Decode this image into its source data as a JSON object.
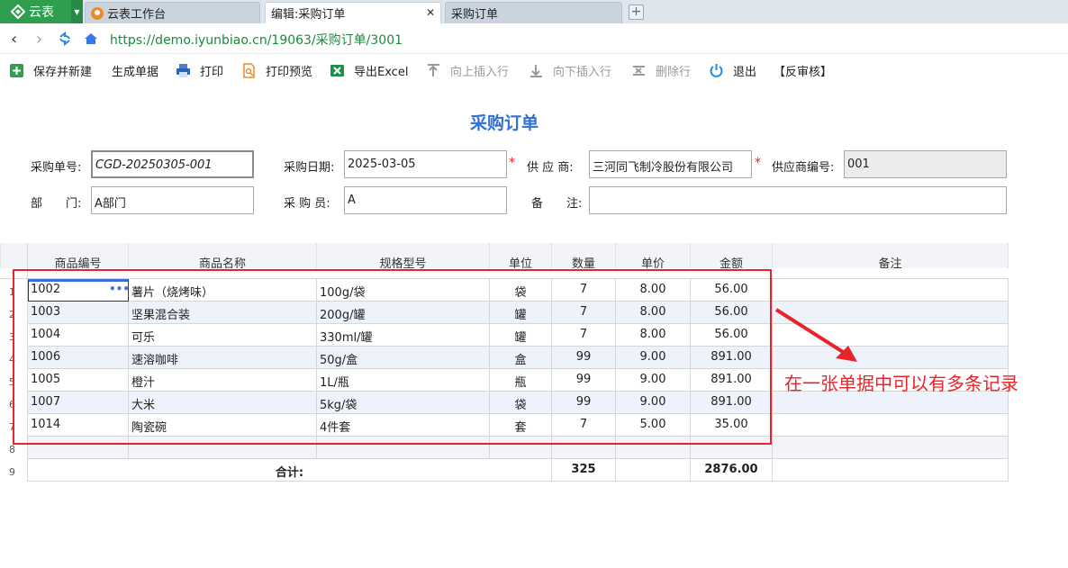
{
  "tabs": {
    "app_name": "云表",
    "items": [
      {
        "label": "云表工作台"
      },
      {
        "label": "编辑:采购订单"
      },
      {
        "label": "采购订单"
      }
    ]
  },
  "address": {
    "url": "https://demo.iyunbiao.cn/19063/采购订单/3001"
  },
  "toolbar": {
    "save_new": "保存并新建",
    "generate": "生成单据",
    "print": "打印",
    "print_preview": "打印预览",
    "export_excel": "导出Excel",
    "insert_above": "向上插入行",
    "insert_below": "向下插入行",
    "delete_row": "删除行",
    "exit": "退出",
    "unaudit": "【反审核】"
  },
  "page_title": "采购订单",
  "form": {
    "order_no_label": "采购单号:",
    "order_no": "CGD-20250305-001",
    "date_label": "采购日期:",
    "date": "2025-03-05",
    "supplier_label": "供 应 商:",
    "supplier": "三河同飞制冷股份有限公司",
    "supplier_code_label": "供应商编号:",
    "supplier_code": "001",
    "dept_label": "部　　门:",
    "dept": "A部门",
    "buyer_label": "采 购 员:",
    "buyer": "A",
    "note_label": "备　　注:",
    "note": "",
    "required_mark": "*"
  },
  "grid": {
    "headers": [
      "商品编号",
      "商品名称",
      "规格型号",
      "单位",
      "数量",
      "单价",
      "金额",
      "备注"
    ],
    "rows": [
      {
        "n": "1",
        "code": "1002",
        "name": "薯片（烧烤味）",
        "spec": "100g/袋",
        "unit": "袋",
        "qty": "7",
        "price": "8.00",
        "amount": "56.00"
      },
      {
        "n": "2",
        "code": "1003",
        "name": "坚果混合装",
        "spec": "200g/罐",
        "unit": "罐",
        "qty": "7",
        "price": "8.00",
        "amount": "56.00"
      },
      {
        "n": "3",
        "code": "1004",
        "name": "可乐",
        "spec": "330ml/罐",
        "unit": "罐",
        "qty": "7",
        "price": "8.00",
        "amount": "56.00"
      },
      {
        "n": "4",
        "code": "1006",
        "name": "速溶咖啡",
        "spec": "50g/盒",
        "unit": "盒",
        "qty": "99",
        "price": "9.00",
        "amount": "891.00"
      },
      {
        "n": "5",
        "code": "1005",
        "name": "橙汁",
        "spec": "1L/瓶",
        "unit": "瓶",
        "qty": "99",
        "price": "9.00",
        "amount": "891.00"
      },
      {
        "n": "6",
        "code": "1007",
        "name": "大米",
        "spec": "5kg/袋",
        "unit": "袋",
        "qty": "99",
        "price": "9.00",
        "amount": "891.00"
      },
      {
        "n": "7",
        "code": "1014",
        "name": "陶瓷碗",
        "spec": "4件套",
        "unit": "套",
        "qty": "7",
        "price": "5.00",
        "amount": "35.00"
      },
      {
        "n": "8",
        "code": "",
        "name": "",
        "spec": "",
        "unit": "",
        "qty": "",
        "price": "",
        "amount": ""
      }
    ],
    "total_row_num": "9",
    "total_label": "合计:",
    "total_qty": "325",
    "total_amount": "2876.00"
  },
  "annotation": "在一张单据中可以有多条记录",
  "colors": {
    "accent": "#2f6fd6",
    "brand": "#2f9e4f",
    "highlight": "#e8242b"
  }
}
